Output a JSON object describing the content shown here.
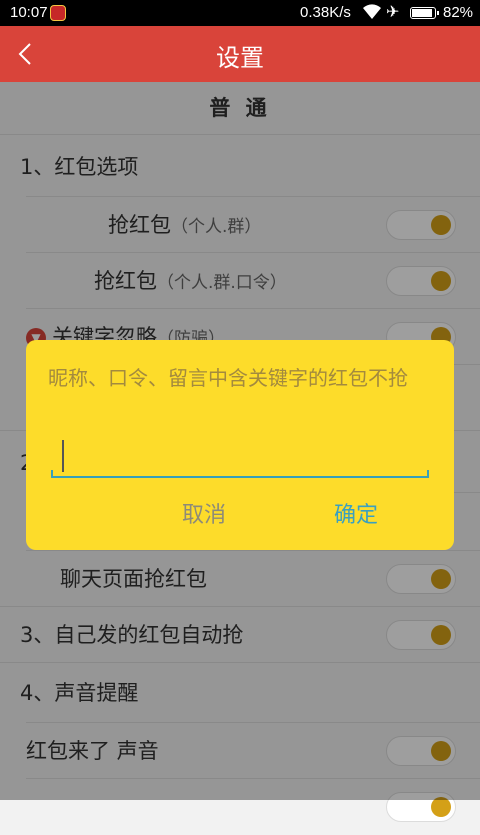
{
  "status_bar": {
    "time": "10:07",
    "network_speed": "0.38K/s",
    "battery_percent": "82%",
    "battery_level": 0.82,
    "icons": [
      "app-notification-icon",
      "wifi-icon",
      "airplane-mode-icon",
      "battery-icon"
    ]
  },
  "header": {
    "title": "设置",
    "back_icon": "chevron-left-icon",
    "color": "#d9443a"
  },
  "section": {
    "title": "普 通"
  },
  "groups": [
    {
      "title": "1、红包选项",
      "rows": [
        {
          "label": "抢红包",
          "sub": "（个人.群）",
          "toggle_on": true
        },
        {
          "label": "抢红包",
          "sub": "（个人.群.口令）",
          "toggle_on": true
        },
        {
          "label": "关键字忽略",
          "sub": "（防骗）",
          "toggle_on": true,
          "icon": "warning-icon"
        }
      ]
    },
    {
      "title": "2",
      "rows": [
        {
          "label": "聊天页面抢红包",
          "toggle_on": true
        }
      ]
    },
    {
      "title": "3、自己发的红包自动抢",
      "toggle_on": true
    },
    {
      "title": "4、声音提醒",
      "rows": [
        {
          "label": "红包来了 声音",
          "toggle_on": true
        }
      ]
    }
  ],
  "dialog": {
    "message": "昵称、口令、留言中含关键字的红包不抢",
    "input_value": "",
    "cancel_label": "取消",
    "confirm_label": "确定",
    "background": "#fddc2a",
    "accent": "#3aa0c0"
  },
  "colors": {
    "toggle_knob": "#d4a017"
  }
}
